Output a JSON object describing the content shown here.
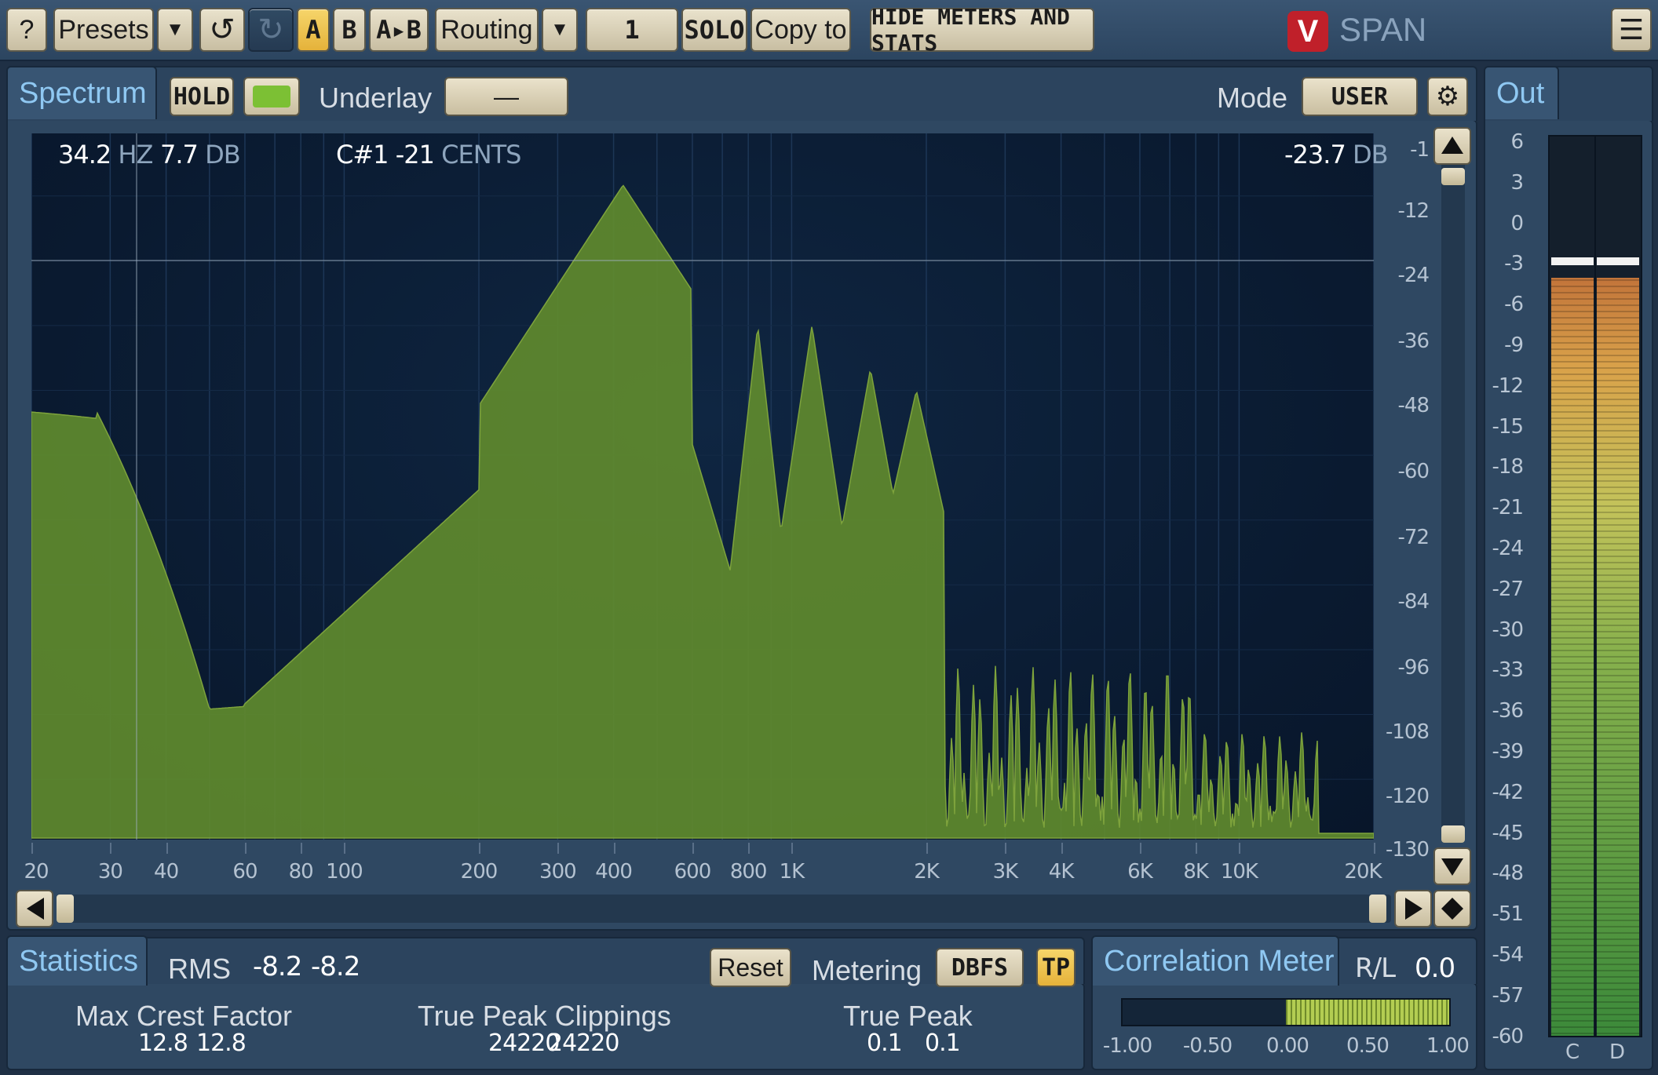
{
  "toolbar": {
    "help": "?",
    "presets": "Presets",
    "dropdown": "▼",
    "undo": "↺",
    "a": "A",
    "b": "B",
    "ab": "A▸B",
    "routing": "Routing",
    "channel": "1",
    "solo": "SOLO",
    "copy_to": "Copy to",
    "hide_meters": "HIDE METERS AND STATS",
    "brand": "SPAN",
    "menu": "☰"
  },
  "spectrum": {
    "tab": "Spectrum",
    "hold": "HOLD",
    "underlay_label": "Underlay",
    "underlay_value": "—",
    "mode_label": "Mode",
    "mode_value": "USER",
    "readout": {
      "freq": "34.2",
      "freq_unit": "HZ",
      "level": "7.7",
      "level_unit": "DB",
      "note": "C#1",
      "cents": "-21",
      "cents_unit": "CENTS",
      "cursor_db": "-23.7",
      "cursor_db_unit": "DB"
    },
    "y_ticks": [
      "-1",
      "-12",
      "-24",
      "-36",
      "-48",
      "-60",
      "-72",
      "-84",
      "-96",
      "-108",
      "-120",
      "-130"
    ],
    "x_ticks": [
      "20",
      "30",
      "40",
      "60",
      "80",
      "100",
      "200",
      "300",
      "400",
      "600",
      "800",
      "1K",
      "2K",
      "3K",
      "4K",
      "6K",
      "8K",
      "10K",
      "20K"
    ]
  },
  "statistics": {
    "tab": "Statistics",
    "rms_label": "RMS",
    "rms_l": "-8.2",
    "rms_r": "-8.2",
    "reset": "Reset",
    "metering_label": "Metering",
    "metering_value": "DBFS",
    "tp": "TP",
    "crest_label": "Max Crest Factor",
    "crest_l": "12.8",
    "crest_r": "12.8",
    "clip_label": "True Peak Clippings",
    "clip_l": "24220",
    "clip_r": "24220",
    "tp_label": "True Peak",
    "tp_l": "0.1",
    "tp_r": "0.1"
  },
  "correlation": {
    "tab": "Correlation Meter",
    "rl": "R/L",
    "value": "0.0",
    "ticks": [
      "-1.00",
      "-0.50",
      "0.00",
      "0.50",
      "1.00"
    ]
  },
  "out": {
    "tab": "Out",
    "ticks": [
      "6",
      "3",
      "0",
      "-3",
      "-6",
      "-9",
      "-12",
      "-15",
      "-18",
      "-21",
      "-24",
      "-27",
      "-30",
      "-33",
      "-36",
      "-39",
      "-42",
      "-45",
      "-48",
      "-51",
      "-54",
      "-57",
      "-60"
    ],
    "ch_l": "C",
    "ch_r": "D"
  },
  "colors": {
    "spectrum_fill": "#5f8a2e",
    "accent_blue": "#8fc8f2",
    "button_cream": "#e0d6bb"
  }
}
